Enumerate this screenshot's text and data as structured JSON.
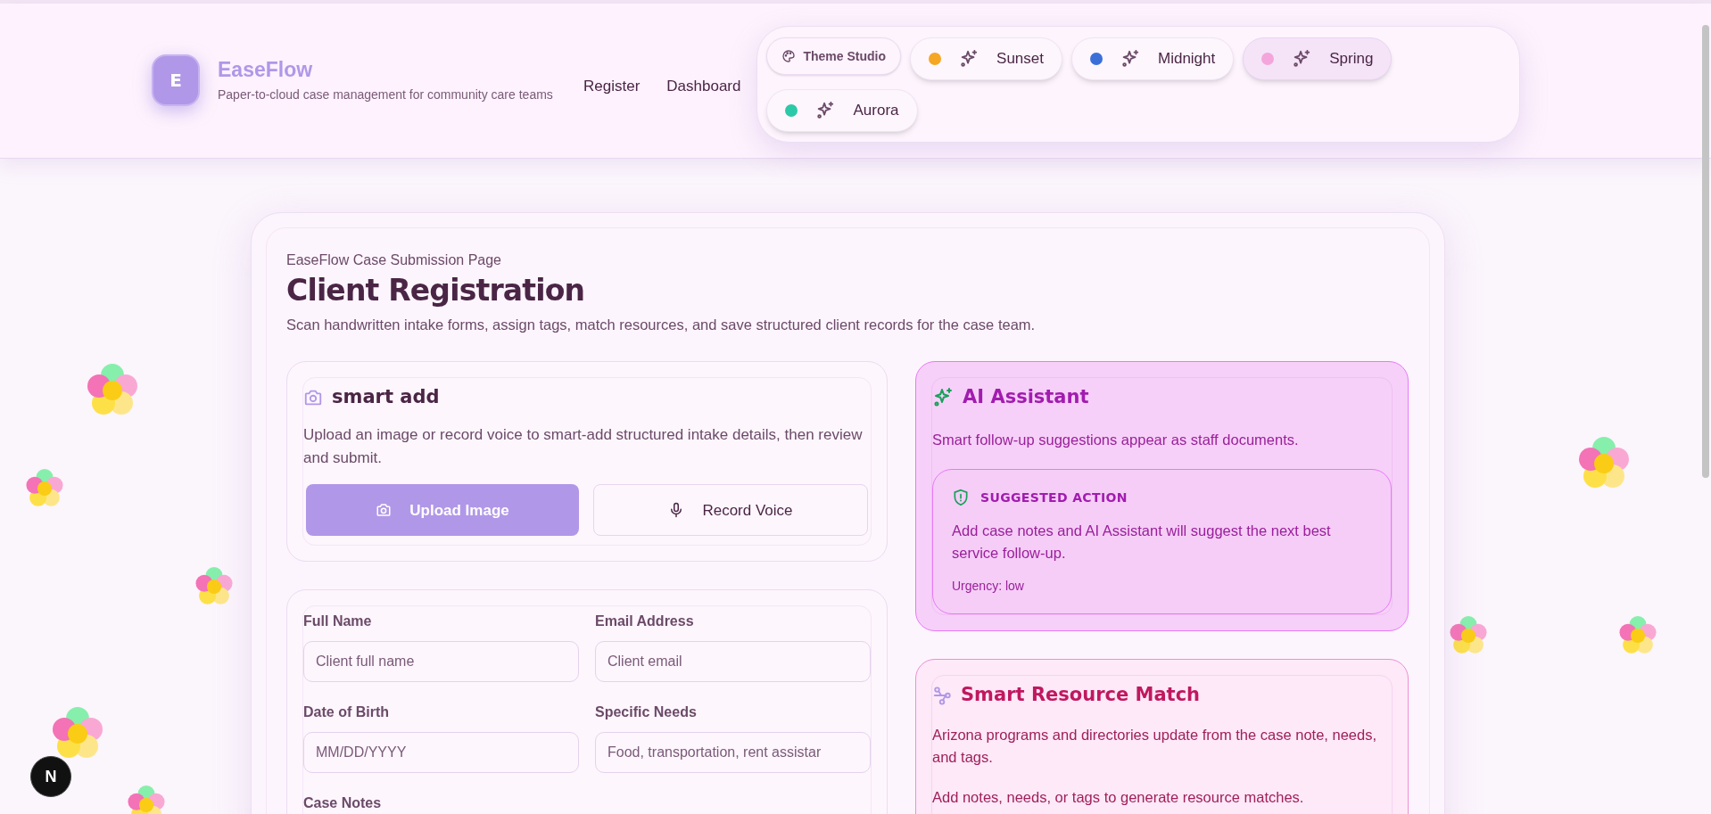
{
  "brand": {
    "logo_letter": "E",
    "name": "EaseFlow",
    "tagline": "Paper-to-cloud case management for community care teams"
  },
  "nav": [
    "Register",
    "Dashboard"
  ],
  "theme_studio": {
    "label": "Theme Studio",
    "themes": [
      {
        "label": "Sunset",
        "color": "#f5a623",
        "selected": false
      },
      {
        "label": "Midnight",
        "color": "#3b6fd8",
        "selected": false
      },
      {
        "label": "Spring",
        "color": "#f4a6dc",
        "selected": true
      },
      {
        "label": "Aurora",
        "color": "#2cc9a8",
        "selected": false
      }
    ]
  },
  "page": {
    "eyebrow": "EaseFlow Case Submission Page",
    "title": "Client Registration",
    "subtitle": "Scan handwritten intake forms, assign tags, match resources, and save structured client records for the case team."
  },
  "smart_add": {
    "title": "smart add",
    "description": "Upload an image or record voice to smart-add structured intake details, then review and submit.",
    "buttons": [
      {
        "label": "Upload Image",
        "kind": "primary"
      },
      {
        "label": "Record Voice",
        "kind": "secondary"
      }
    ]
  },
  "form": {
    "fields": [
      {
        "label": "Full Name",
        "placeholder": "Client full name"
      },
      {
        "label": "Email Address",
        "placeholder": "Client email"
      },
      {
        "label": "Date of Birth",
        "placeholder": "MM/DD/YYYY"
      },
      {
        "label": "Specific Needs",
        "placeholder": "Food, transportation, rent assistar"
      }
    ],
    "notes_label": "Case Notes"
  },
  "ai_assistant": {
    "title": "AI Assistant",
    "description": "Smart follow-up suggestions appear as staff documents.",
    "suggestion": {
      "heading": "SUGGESTED ACTION",
      "text": "Add case notes and AI Assistant will suggest the next best service follow-up.",
      "urgency": "Urgency: low"
    }
  },
  "resource_match": {
    "title": "Smart Resource Match",
    "paragraphs": [
      "Arizona programs and directories update from the case note, needs, and tags.",
      "Add notes, needs, or tags to generate resource matches."
    ]
  },
  "dev_badge": "N"
}
